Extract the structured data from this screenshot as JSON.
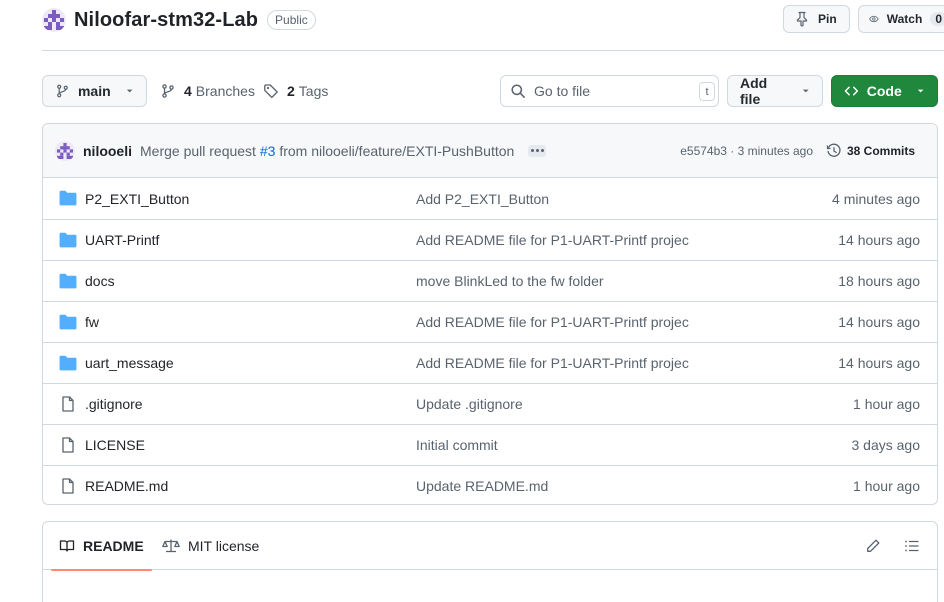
{
  "repo": {
    "name": "Niloofar-stm32-Lab",
    "visibility": "Public",
    "pin_label": "Pin",
    "watch_label": "Watch",
    "watch_count": "0"
  },
  "toolbar": {
    "branch": "main",
    "branches_count": "4",
    "branches_label": "Branches",
    "tags_count": "2",
    "tags_label": "Tags",
    "search_placeholder": "Go to file",
    "search_kbd": "t",
    "add_file_label": "Add file",
    "code_label": "Code",
    "code_color": "#1f883d"
  },
  "latest_commit": {
    "author": "nilooeli",
    "message_prefix": "Merge pull request",
    "pr_link": "#3",
    "message_suffix": "from nilooeli/feature/EXTI-PushButton",
    "hash_time": "e5574b3 · 3 minutes ago",
    "commits_label": "38 Commits"
  },
  "files": [
    {
      "type": "folder",
      "icon": "folder-icon",
      "name": "P2_EXTI_Button",
      "message": "Add P2_EXTI_Button",
      "date": "4 minutes ago"
    },
    {
      "type": "folder",
      "icon": "folder-icon",
      "name": "UART-Printf",
      "message": "Add README file for P1-UART-Printf projec",
      "date": "14 hours ago"
    },
    {
      "type": "folder",
      "icon": "folder-icon",
      "name": "docs",
      "message": "move BlinkLed to the fw folder",
      "date": "18 hours ago"
    },
    {
      "type": "folder",
      "icon": "folder-icon",
      "name": "fw",
      "message": "Add README file for P1-UART-Printf projec",
      "date": "14 hours ago"
    },
    {
      "type": "folder",
      "icon": "folder-icon",
      "name": "uart_message",
      "message": "Add README file for P1-UART-Printf projec",
      "date": "14 hours ago"
    },
    {
      "type": "file",
      "icon": "file-icon",
      "name": ".gitignore",
      "message": "Update .gitignore",
      "date": "1 hour ago"
    },
    {
      "type": "file",
      "icon": "file-icon",
      "name": "LICENSE",
      "message": "Initial commit",
      "date": "3 days ago"
    },
    {
      "type": "file",
      "icon": "file-icon",
      "name": "README.md",
      "message": "Update README.md",
      "date": "1 hour ago"
    }
  ],
  "readme": {
    "tab_readme": "README",
    "tab_license": "MIT license",
    "active_underline_color": "#fd8c73"
  }
}
